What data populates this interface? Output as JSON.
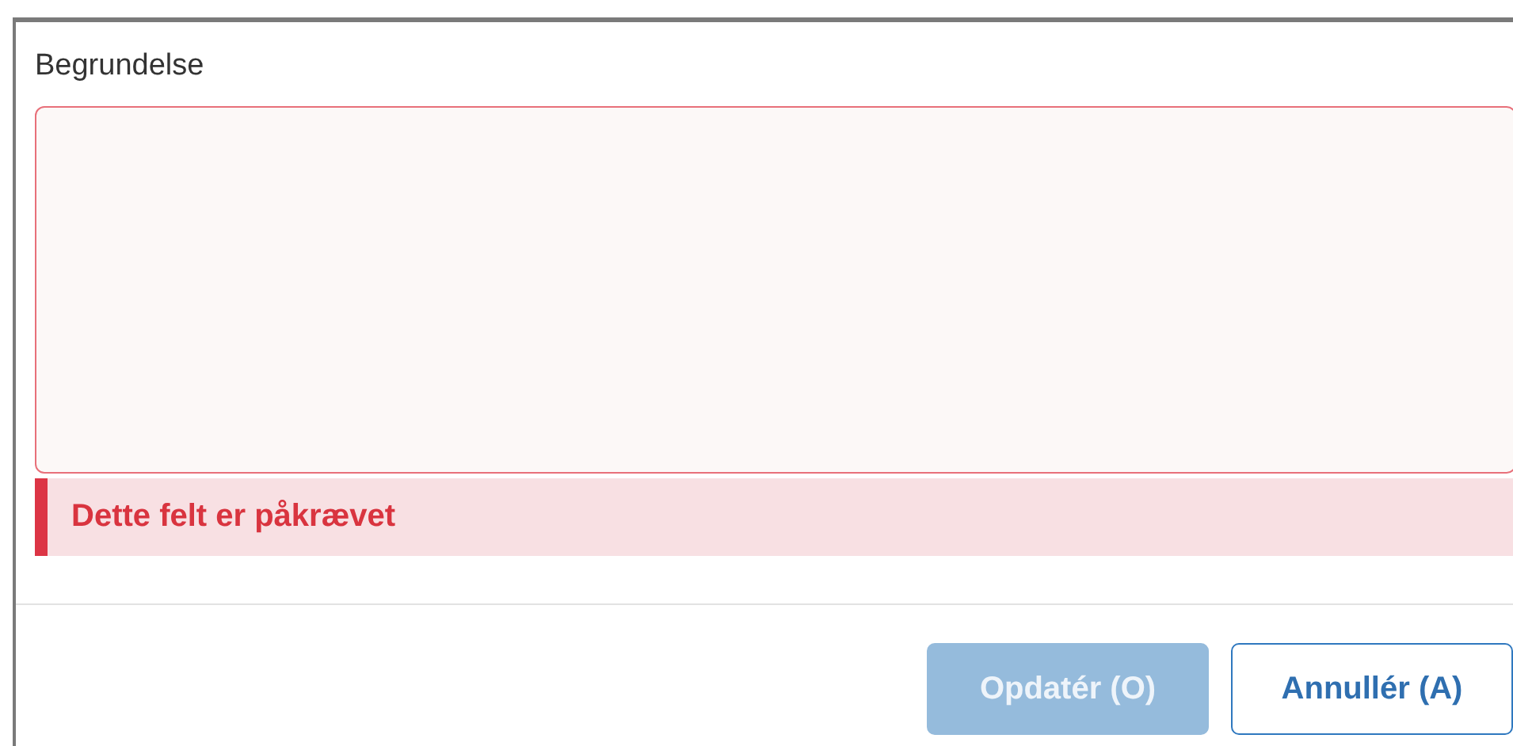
{
  "field": {
    "label": "Begrundelse",
    "invalid": true,
    "error": "Dette felt er påkrævet"
  },
  "buttons": [
    {
      "label": "Opdatér (O)",
      "kind": "primary",
      "disabled": true
    },
    {
      "label": "Annullér (A)",
      "kind": "secondary",
      "disabled": false
    }
  ]
}
